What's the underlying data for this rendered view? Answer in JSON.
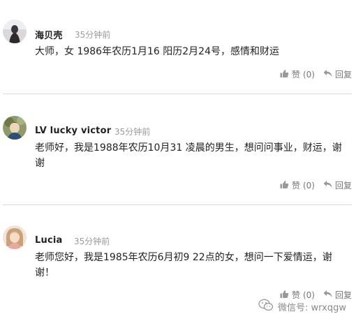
{
  "comments": [
    {
      "username": "海贝壳",
      "time": "35分钟前",
      "content": "大师，女 1986年农历1月16 阳历2月24号，感情和财运",
      "like_label": "赞",
      "like_count": "(0)",
      "reply_label": "回复"
    },
    {
      "username": "LV lucky victor",
      "time": "35分钟前",
      "content": "老师好，我是1988年农历10月31 凌晨的男生，想问问事业，财运，谢谢",
      "like_label": "赞",
      "like_count": "(0)",
      "reply_label": "回复"
    },
    {
      "username": "Lucia",
      "time": "35分钟前",
      "content": "老师您好，我是1985年农历6月初9 22点的女，想问一下爱情运，谢谢！",
      "like_label": "赞",
      "like_count": "(0)",
      "reply_label": "回复"
    }
  ],
  "watermark": {
    "text": "微信号: wrxqgw",
    "icon": "wechat-logo-icon"
  },
  "colors": {
    "time": "#9a9a9a",
    "action": "#777777",
    "divider": "#d9d9d9"
  }
}
